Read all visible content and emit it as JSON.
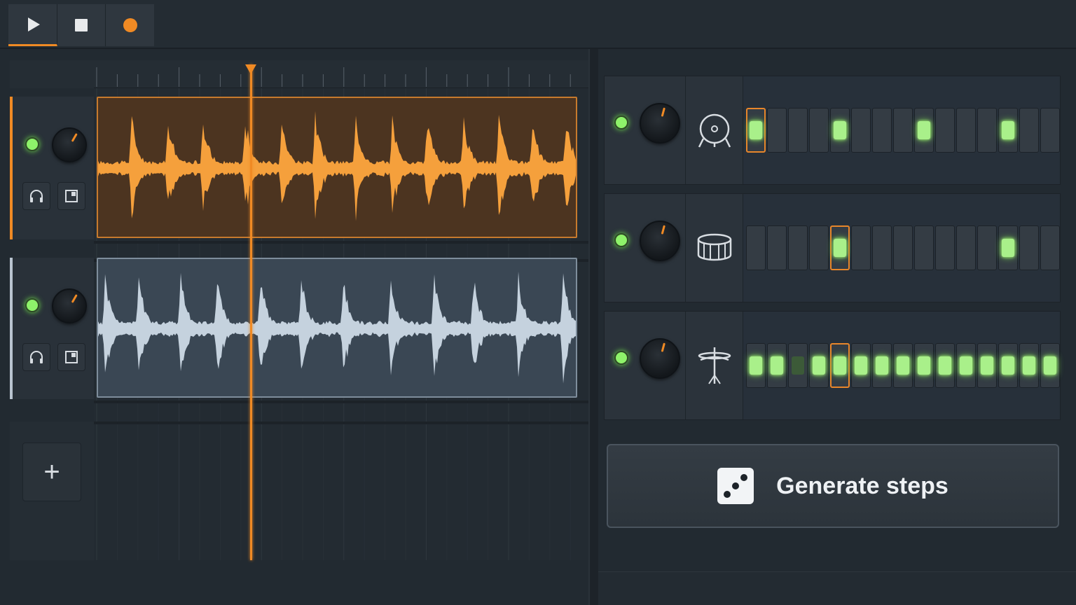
{
  "transport": {
    "buttons": [
      {
        "name": "play",
        "icon": "play-icon",
        "active": true
      },
      {
        "name": "stop",
        "icon": "stop-icon",
        "active": false
      },
      {
        "name": "record",
        "icon": "record-icon",
        "active": false
      }
    ]
  },
  "colors": {
    "accent": "#f08a24",
    "step_on": "#a9f08a",
    "led": "#8ef26a",
    "audio_clip_1": "#f5a03c",
    "audio_clip_2": "#c5d2de"
  },
  "arrangement": {
    "tracks": [
      {
        "name": "audio-track-1",
        "enabled": true,
        "icons": [
          "headphones-icon",
          "expand-icon"
        ],
        "waveform_color": "#f5a03c"
      },
      {
        "name": "audio-track-2",
        "enabled": true,
        "icons": [
          "headphones-icon",
          "expand-icon"
        ],
        "waveform_color": "#c5d2de"
      }
    ],
    "add_track_label": "+"
  },
  "sequencer": {
    "rows": [
      {
        "instrument_icon": "kick-drum-icon",
        "enabled": true,
        "steps": [
          1,
          0,
          0,
          0,
          1,
          0,
          0,
          0,
          1,
          0,
          0,
          0,
          1,
          0,
          0
        ],
        "current_step": 0
      },
      {
        "instrument_icon": "snare-drum-icon",
        "enabled": true,
        "steps": [
          0,
          0,
          0,
          0,
          1,
          0,
          0,
          0,
          0,
          0,
          0,
          0,
          1,
          0,
          0
        ],
        "current_step": 4
      },
      {
        "instrument_icon": "hi-hat-icon",
        "enabled": true,
        "steps": [
          1,
          1,
          2,
          1,
          1,
          1,
          1,
          1,
          1,
          1,
          1,
          1,
          1,
          1,
          1
        ],
        "current_step": 4
      }
    ]
  },
  "generate": {
    "label": "Generate steps",
    "icon": "dice-icon"
  }
}
